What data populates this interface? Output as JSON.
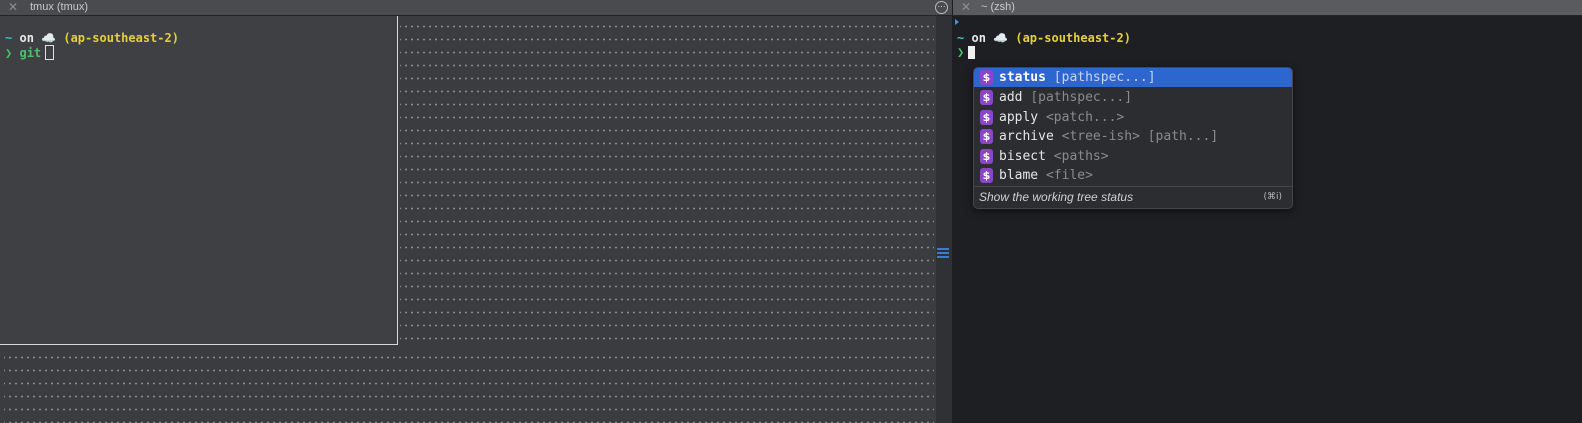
{
  "left_window": {
    "title": "tmux (tmux)",
    "close_glyph": "✕",
    "more_glyph": "⋯",
    "prompt": {
      "tilde": "~",
      "on": "on",
      "cloud": "☁️",
      "region": "(ap-southeast-2)",
      "arrow": "❯",
      "command": "git"
    }
  },
  "right_window": {
    "title": "~ (zsh)",
    "close_glyph": "✕",
    "prompt": {
      "tilde": "~",
      "on": "on",
      "cloud": "☁️",
      "region": "(ap-southeast-2)",
      "arrow": "❯"
    }
  },
  "autocomplete": {
    "badge": "$",
    "items": [
      {
        "name": "status",
        "args": "[pathspec...]",
        "selected": true
      },
      {
        "name": "add",
        "args": "[pathspec...]",
        "selected": false
      },
      {
        "name": "apply",
        "args": "<patch...>",
        "selected": false
      },
      {
        "name": "archive",
        "args": "<tree-ish> [path...]",
        "selected": false
      },
      {
        "name": "bisect",
        "args": "<paths>",
        "selected": false
      },
      {
        "name": "blame",
        "args": "<file>",
        "selected": false
      }
    ],
    "description": "Show the working tree status",
    "shortcut": "(⌘i)"
  },
  "colors": {
    "selection": "#2e66d0",
    "badge": "#8b45c8",
    "region": "#e3d03a",
    "command": "#4ac26b"
  }
}
